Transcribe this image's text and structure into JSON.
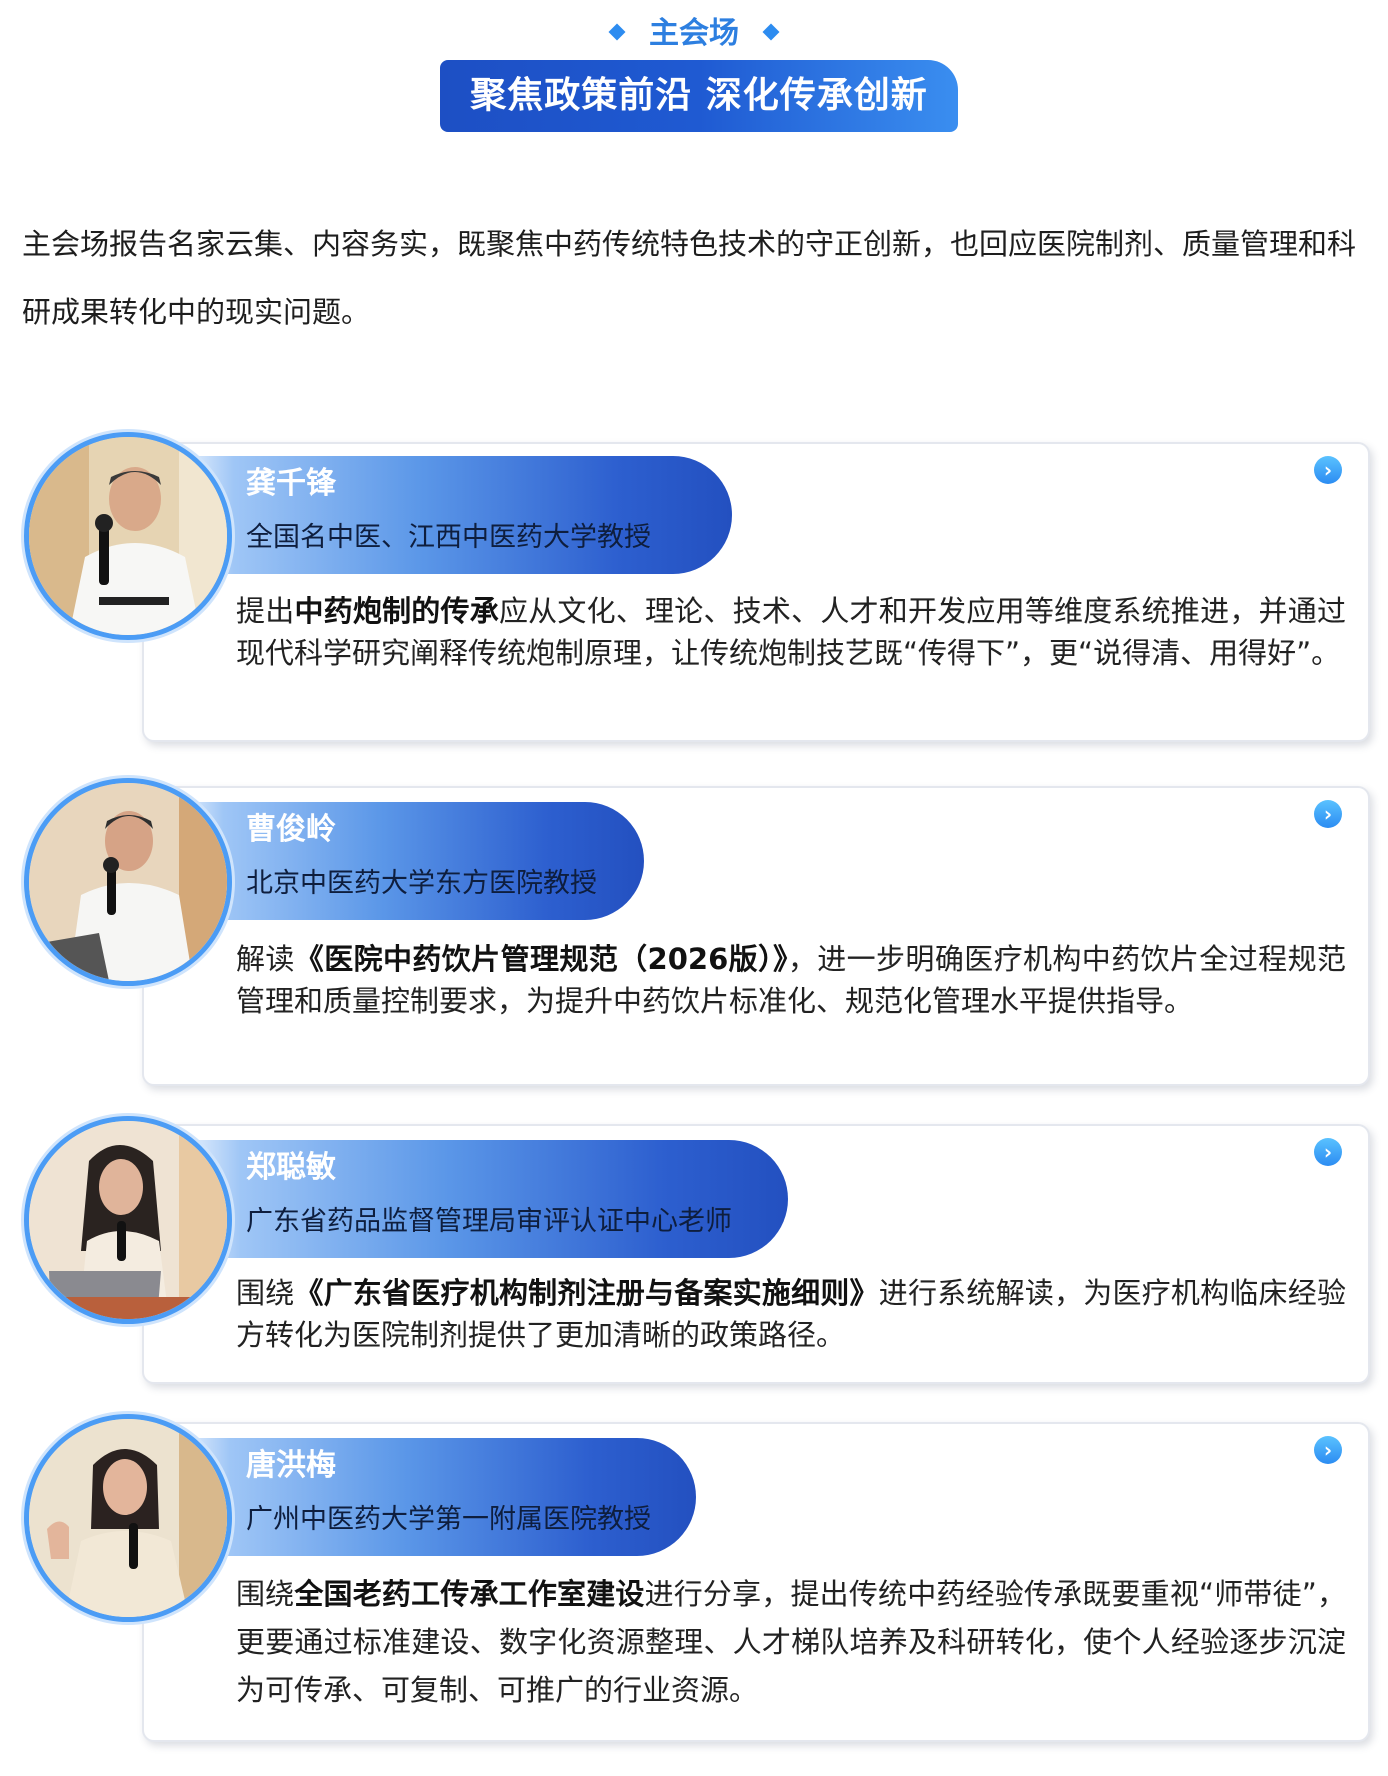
{
  "header": {
    "section_label": "主会场",
    "title": "聚焦政策前沿 深化传承创新"
  },
  "intro": "主会场报告名家云集、内容务实，既聚焦中药传统特色技术的守正创新，也回应医院制剂、质量管理和科研成果转化中的现实问题。",
  "speakers": [
    {
      "name": "龚千锋",
      "role": "全国名中医、江西中医药大学教授",
      "desc_pre": "提出",
      "desc_bold": "中药炮制的传承",
      "desc_post": "应从文化、理论、技术、人才和开发应用等维度系统推进，并通过现代科学研究阐释传统炮制原理，让传统炮制技艺既“传得下”，更“说得清、用得好”。"
    },
    {
      "name": "曹俊岭",
      "role": "北京中医药大学东方医院教授",
      "desc_pre": "解读",
      "desc_bold": "《医院中药饮片管理规范（2026版）》",
      "desc_post": "，进一步明确医疗机构中药饮片全过程规范管理和质量控制要求，为提升中药饮片标准化、规范化管理水平提供指导。"
    },
    {
      "name": "郑聪敏",
      "role": "广东省药品监督管理局审评认证中心老师",
      "desc_pre": "围绕",
      "desc_bold": "《广东省医疗机构制剂注册与备案实施细则》",
      "desc_post": "进行系统解读，为医疗机构临床经验方转化为医院制剂提供了更加清晰的政策路径。"
    },
    {
      "name": "唐洪梅",
      "role": "广州中医药大学第一附属医院教授",
      "desc_pre": "围绕",
      "desc_bold": "全国老药工传承工作室建设",
      "desc_post": "进行分享，提出传统中药经验传承既要重视“师带徒”，更要通过标准建设、数字化资源整理、人才梯队培养及科研转化，使个人经验逐步沉淀为可传承、可复制、可推广的行业资源。"
    }
  ],
  "icons": {
    "card_arrow": "chevron-right-circle-icon",
    "section_marker": "diamond-icon"
  },
  "colors": {
    "accent": "#2d7fe0",
    "banner_dark": "#1d4fc4",
    "banner_light": "#3a8ef0"
  }
}
